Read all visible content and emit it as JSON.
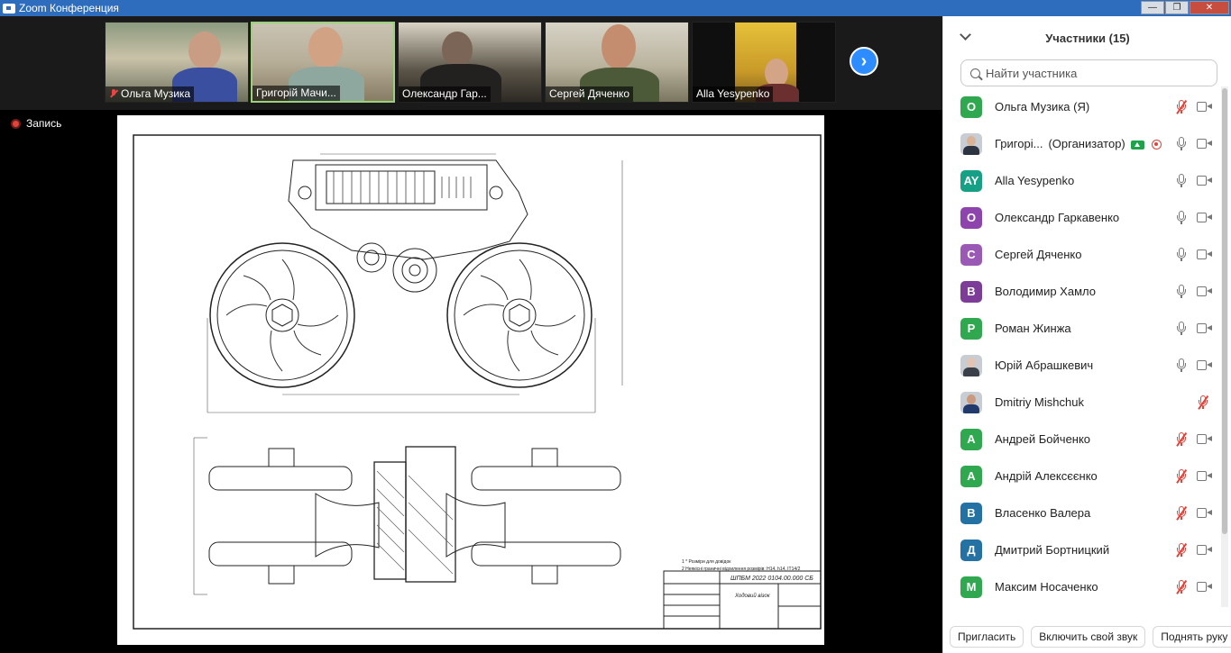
{
  "window": {
    "title": "Zoom Конференция",
    "controls": [
      "—",
      "❐",
      "✕"
    ]
  },
  "video_strip": {
    "tiles": [
      {
        "name": "Ольга Музика",
        "muted": true,
        "active": false
      },
      {
        "name": "Григорій Мачи...",
        "muted": false,
        "active": true
      },
      {
        "name": "Олександр Гар...",
        "muted": false,
        "active": false
      },
      {
        "name": "Сергей Дяченко",
        "muted": false,
        "active": false
      },
      {
        "name": "Alla Yesypenko",
        "muted": false,
        "active": false
      }
    ],
    "next_icon": "chevron-right-icon",
    "next_glyph": "›"
  },
  "recording": {
    "label": "Запись"
  },
  "shared_drawing": {
    "title_block_code": "ШПБМ 2022 0104.00.000 СБ",
    "title_block_name": "Ходовий візок",
    "notes": [
      "1 * Розміри для довідок",
      "2 Неякісні граничні відхилення розмірів: H14, h14, IT14/2"
    ]
  },
  "participants": {
    "title": "Участники (15)",
    "search_placeholder": "Найти участника",
    "list": [
      {
        "name": "Ольга Музика (Я)",
        "initials": "О",
        "color": "#2fa84f",
        "photo": false,
        "mic_muted": true,
        "video": true
      },
      {
        "name": "Григорі...",
        "role": "(Организатор)",
        "initials": "",
        "color": "",
        "photo": true,
        "mic_muted": false,
        "video": true,
        "sharing": true,
        "recording": true
      },
      {
        "name": "Alla Yesypenko",
        "initials": "AY",
        "color": "#16a085",
        "photo": false,
        "mic_muted": false,
        "video": true
      },
      {
        "name": "Олександр Гаркавенко",
        "initials": "О",
        "color": "#8e44ad",
        "photo": false,
        "mic_muted": false,
        "video": true
      },
      {
        "name": "Сергей Дяченко",
        "initials": "С",
        "color": "#9b59b6",
        "photo": false,
        "mic_muted": false,
        "video": true
      },
      {
        "name": "Володимир Хамло",
        "initials": "В",
        "color": "#7d3c98",
        "photo": false,
        "mic_muted": false,
        "video": true
      },
      {
        "name": "Роман Жинжа",
        "initials": "Р",
        "color": "#2fa84f",
        "photo": false,
        "mic_muted": false,
        "video": true
      },
      {
        "name": "Юрій Абрашкевич",
        "initials": "",
        "color": "",
        "photo": true,
        "mic_muted": false,
        "video": true
      },
      {
        "name": "Dmitriy Mishchuk",
        "initials": "",
        "color": "",
        "photo": true,
        "mic_muted": true,
        "video": false
      },
      {
        "name": "Андрей Бойченко",
        "initials": "А",
        "color": "#2fa84f",
        "photo": false,
        "mic_muted": true,
        "video": true
      },
      {
        "name": "Андрій Алексєєнко",
        "initials": "А",
        "color": "#2fa84f",
        "photo": false,
        "mic_muted": true,
        "video": true
      },
      {
        "name": "Власенко Валера",
        "initials": "В",
        "color": "#2471a3",
        "photo": false,
        "mic_muted": true,
        "video": true
      },
      {
        "name": "Дмитрий Бортницкий",
        "initials": "Д",
        "color": "#2471a3",
        "photo": false,
        "mic_muted": true,
        "video": true
      },
      {
        "name": "Максим Носаченко",
        "initials": "М",
        "color": "#2fa84f",
        "photo": false,
        "mic_muted": true,
        "video": true
      }
    ],
    "buttons": {
      "invite": "Пригласить",
      "unmute": "Включить свой звук",
      "raise_hand": "Поднять руку"
    }
  }
}
